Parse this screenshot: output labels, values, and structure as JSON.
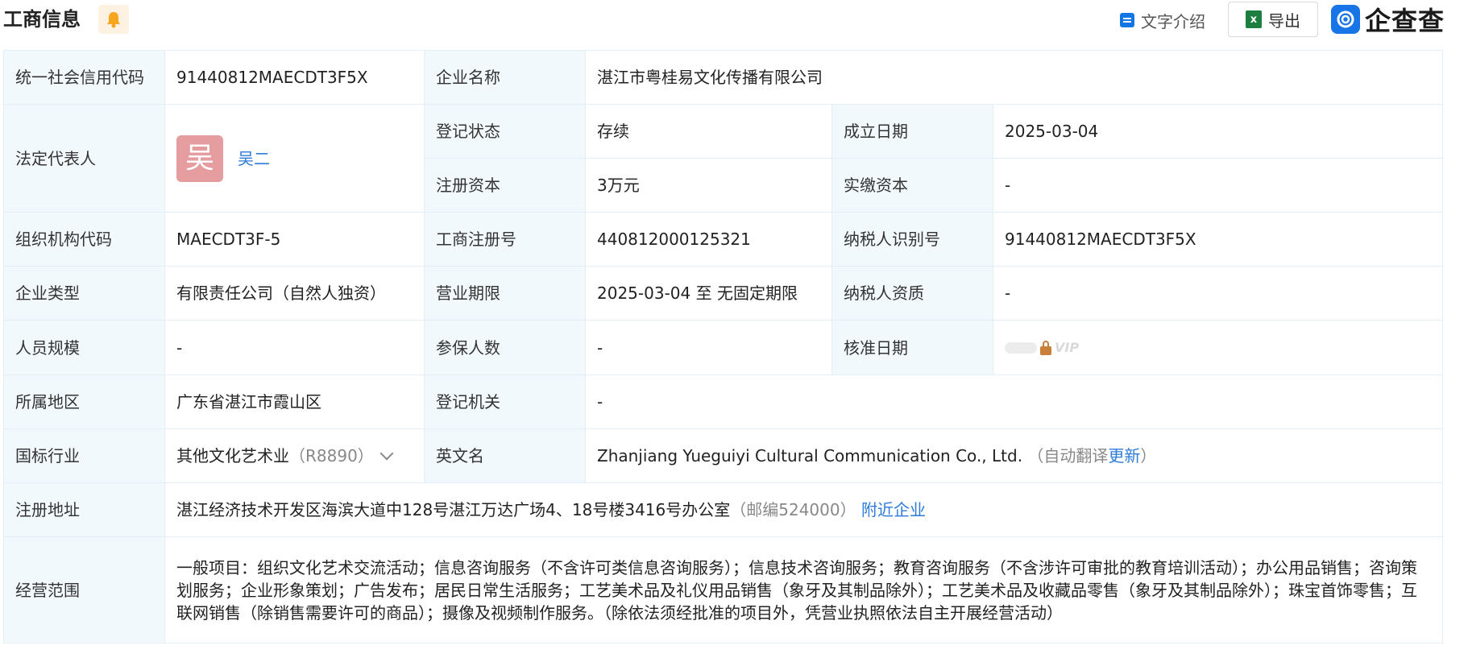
{
  "header": {
    "title": "工商信息",
    "bell_icon": "bell-icon",
    "text_intro_label": "文字介绍",
    "export_label": "导出",
    "brand_name": "企查查"
  },
  "colors": {
    "key_cell_bg": "#f2f9fc",
    "border": "#e4eef6",
    "link": "#2d7bd9",
    "brand_blue": "#1775e8",
    "avatar_bg": "#e59d9f",
    "bell_bg": "#fdf1e2",
    "bell": "#f7a51c"
  },
  "table": {
    "credit_code_label": "统一社会信用代码",
    "credit_code": "91440812MAECDT3F5X",
    "company_name_label": "企业名称",
    "company_name": "湛江市粤桂易文化传播有限公司",
    "legal_rep_label": "法定代表人",
    "legal_rep_avatar": "吴",
    "legal_rep_name": "吴二",
    "reg_status_label": "登记状态",
    "reg_status": "存续",
    "est_date_label": "成立日期",
    "est_date": "2025-03-04",
    "reg_capital_label": "注册资本",
    "reg_capital": "3万元",
    "paid_capital_label": "实缴资本",
    "paid_capital": "-",
    "org_code_label": "组织机构代码",
    "org_code": "MAECDT3F-5",
    "biz_reg_no_label": "工商注册号",
    "biz_reg_no": "440812000125321",
    "taxpayer_id_label": "纳税人识别号",
    "taxpayer_id": "91440812MAECDT3F5X",
    "company_type_label": "企业类型",
    "company_type": "有限责任公司（自然人独资）",
    "biz_term_label": "营业期限",
    "biz_term": "2025-03-04 至 无固定期限",
    "taxpayer_qual_label": "纳税人资质",
    "taxpayer_qual": "-",
    "staff_size_label": "人员规模",
    "staff_size": "-",
    "insured_count_label": "参保人数",
    "insured_count": "-",
    "approval_date_label": "核准日期",
    "approval_vip": "VIP",
    "region_label": "所属地区",
    "region": "广东省湛江市霞山区",
    "reg_authority_label": "登记机关",
    "reg_authority": "-",
    "industry_label": "国标行业",
    "industry": "其他文化艺术业",
    "industry_code": "（R8890）",
    "english_name_label": "英文名",
    "english_name": "Zhanjiang Yueguiyi Cultural Communication Co., Ltd.",
    "auto_translate_prefix": "（自动翻译",
    "auto_translate_update": "更新",
    "auto_translate_suffix": "）",
    "address_label": "注册地址",
    "address": "湛江经济技术开发区海滨大道中128号湛江万达广场4、18号楼3416号办公室",
    "postcode": "（邮编524000）",
    "nearby_label": "附近企业",
    "scope_label": "经营范围",
    "scope": "一般项目：组织文化艺术交流活动；信息咨询服务（不含许可类信息咨询服务）；信息技术咨询服务；教育咨询服务（不含涉许可审批的教育培训活动）；办公用品销售；咨询策划服务；企业形象策划；广告发布；居民日常生活服务；工艺美术品及礼仪用品销售（象牙及其制品除外）；工艺美术品及收藏品零售（象牙及其制品除外）；珠宝首饰零售；互联网销售（除销售需要许可的商品）；摄像及视频制作服务。（除依法须经批准的项目外，凭营业执照依法自主开展经营活动）"
  }
}
